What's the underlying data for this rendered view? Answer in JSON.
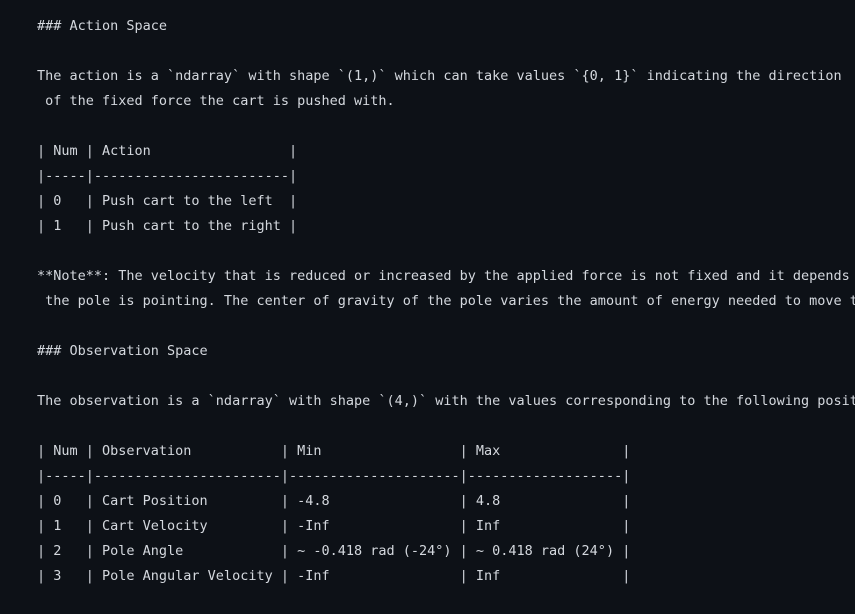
{
  "document": {
    "lines": [
      "### Action Space",
      "",
      "The action is a `ndarray` with shape `(1,)` which can take values `{0, 1}` indicating the direction",
      " of the fixed force the cart is pushed with.",
      "",
      "| Num | Action                 |",
      "|-----|------------------------|",
      "| 0   | Push cart to the left  |",
      "| 1   | Push cart to the right |",
      "",
      "**Note**: The velocity that is reduced or increased by the applied force is not fixed and it depends on the angle",
      " the pole is pointing. The center of gravity of the pole varies the amount of energy needed to move the cart underneath it",
      "",
      "### Observation Space",
      "",
      "The observation is a `ndarray` with shape `(4,)` with the values corresponding to the following positions and velocities:",
      "",
      "| Num | Observation           | Min                 | Max               |",
      "|-----|-----------------------|---------------------|-------------------|",
      "| 0   | Cart Position         | -4.8                | 4.8               |",
      "| 1   | Cart Velocity         | -Inf                | Inf               |",
      "| 2   | Pole Angle            | ~ -0.418 rad (-24°) | ~ 0.418 rad (24°) |",
      "| 3   | Pole Angular Velocity | -Inf                | Inf               |"
    ]
  }
}
